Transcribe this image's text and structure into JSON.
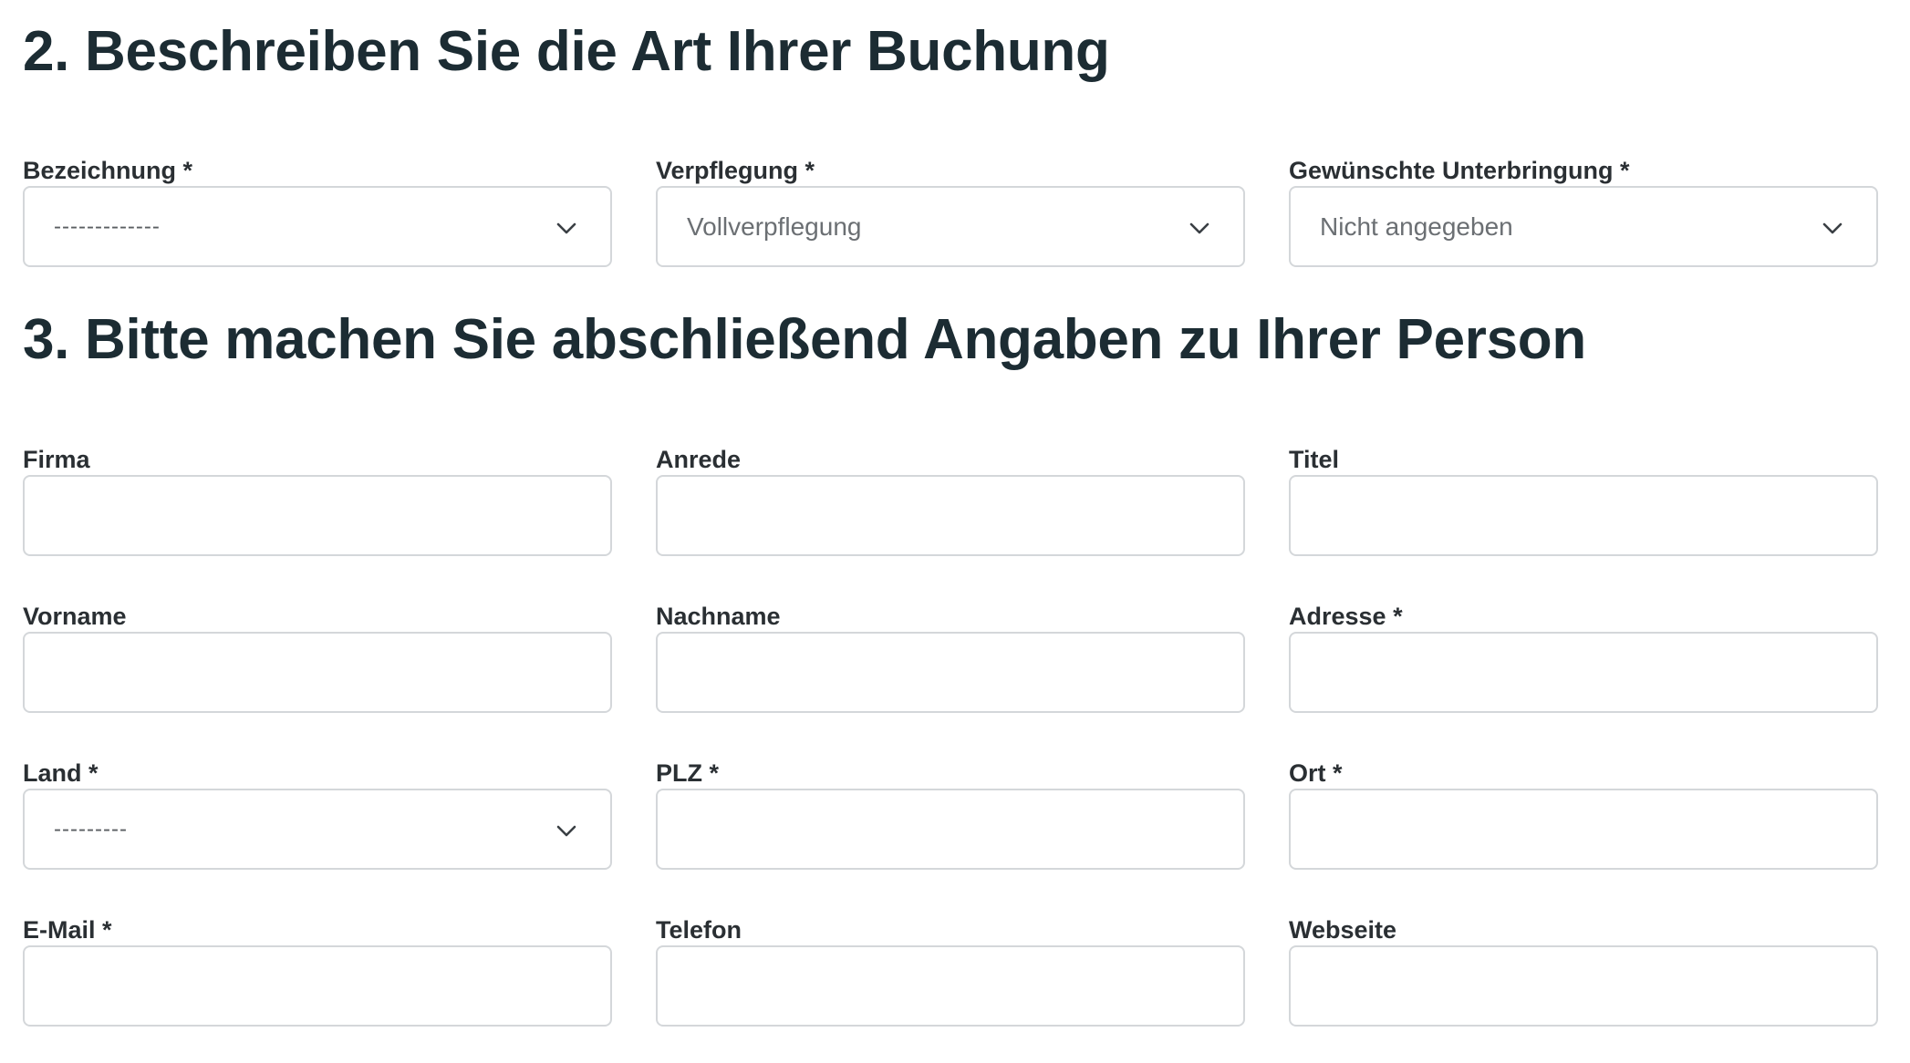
{
  "section2": {
    "title": "2. Beschreiben Sie die Art Ihrer Buchung",
    "fields": {
      "bezeichnung": {
        "label": "Bezeichnung *",
        "value": "-------------"
      },
      "verpflegung": {
        "label": "Verpflegung *",
        "value": "Vollverpflegung"
      },
      "unterbringung": {
        "label": "Gewünschte Unterbringung *",
        "value": "Nicht angegeben"
      }
    }
  },
  "section3": {
    "title": "3. Bitte machen Sie abschließend Angaben zu Ihrer Person",
    "fields": {
      "firma": {
        "label": "Firma",
        "value": ""
      },
      "anrede": {
        "label": "Anrede",
        "value": ""
      },
      "titel": {
        "label": "Titel",
        "value": ""
      },
      "vorname": {
        "label": "Vorname",
        "value": ""
      },
      "nachname": {
        "label": "Nachname",
        "value": ""
      },
      "adresse": {
        "label": "Adresse *",
        "value": ""
      },
      "land": {
        "label": "Land *",
        "value": "---------"
      },
      "plz": {
        "label": "PLZ *",
        "value": ""
      },
      "ort": {
        "label": "Ort *",
        "value": ""
      },
      "email": {
        "label": "E-Mail *",
        "value": ""
      },
      "telefon": {
        "label": "Telefon",
        "value": ""
      },
      "webseite": {
        "label": "Webseite",
        "value": ""
      }
    }
  },
  "icons": {
    "select_arrow": "chevron-down-icon"
  },
  "colors": {
    "heading": "#1c2c33",
    "label": "#2a2f33",
    "border": "#d4d7da",
    "select_text": "#6b6f73"
  }
}
